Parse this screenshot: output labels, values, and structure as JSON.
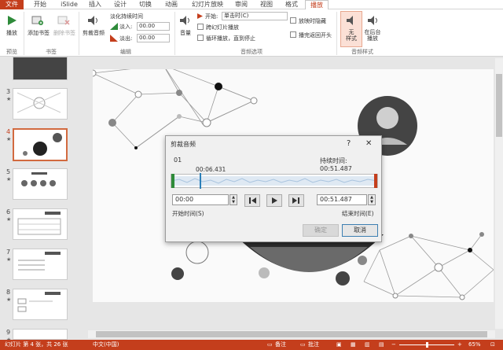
{
  "tabs": [
    "文件",
    "开始",
    "iSlide",
    "插入",
    "设计",
    "切换",
    "动画",
    "幻灯片放映",
    "审阅",
    "视图",
    "格式",
    "播放"
  ],
  "ribbon": {
    "preview": {
      "play": "播放",
      "group": "预览"
    },
    "bookmarks": {
      "add": "添加书签",
      "remove": "删除书签",
      "group": "书签"
    },
    "edit": {
      "trim": "剪裁音频",
      "fade_title": "淡化持续时间",
      "fade_in_label": "淡入:",
      "fade_in_value": "00.00",
      "fade_out_label": "淡出:",
      "fade_out_value": "00.00",
      "group": "编辑"
    },
    "audio_options": {
      "volume": "音量",
      "start_label": "开始:",
      "start_value": "单击时(C)",
      "cross_slides": "跨幻灯片播放",
      "loop": "循环播放，直到停止",
      "hide": "放映时隐藏",
      "rewind": "播完返回开头",
      "group": "音频选项"
    },
    "audio_styles": {
      "none": "无\n样式",
      "background": "在后台\n播放",
      "group": "音频样式"
    }
  },
  "slides": [
    {
      "num": "3",
      "star": "★"
    },
    {
      "num": "4",
      "star": "★"
    },
    {
      "num": "5",
      "star": "★"
    },
    {
      "num": "6",
      "star": "★"
    },
    {
      "num": "7",
      "star": "★"
    },
    {
      "num": "8",
      "star": "★"
    },
    {
      "num": "9",
      "star": "★"
    }
  ],
  "dialog": {
    "title": "剪裁音频",
    "help": "?",
    "close": "✕",
    "track_name": "01",
    "duration_label": "持续时间: 00:51.487",
    "cursor_time": "00:06.431",
    "start_value": "00:00",
    "end_value": "00:51.487",
    "start_label": "开始时间(S)",
    "end_label": "结束时间(E)",
    "ok": "确定",
    "cancel": "取消",
    "progress": 0.125
  },
  "status": {
    "slide": "幻灯片 第 4 张，共 26 张",
    "lang": "中文(中国)",
    "notes": "备注",
    "comments": "批注",
    "zoom": "65%"
  },
  "colors": {
    "accent": "#c43e1c",
    "selected_thumb": "#d26a3f"
  }
}
